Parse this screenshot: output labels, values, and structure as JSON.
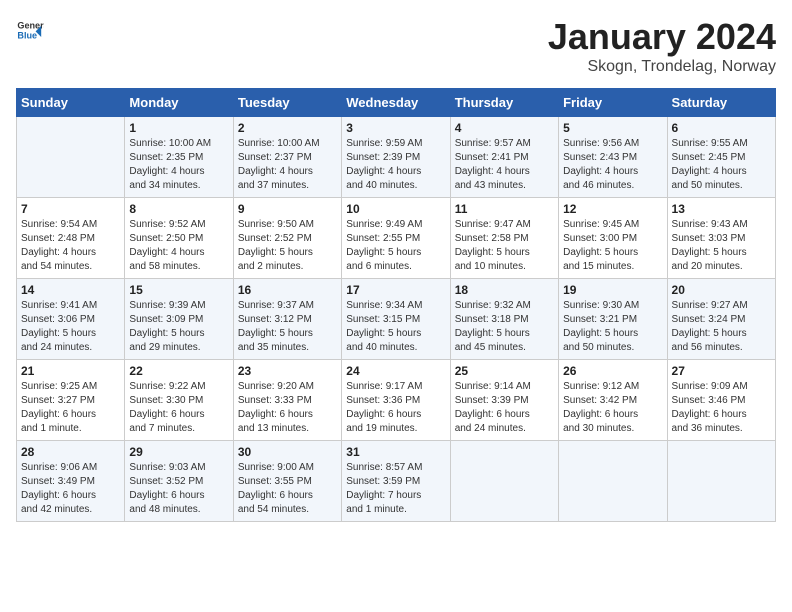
{
  "logo": {
    "general": "General",
    "blue": "Blue"
  },
  "title": "January 2024",
  "subtitle": "Skogn, Trondelag, Norway",
  "headers": [
    "Sunday",
    "Monday",
    "Tuesday",
    "Wednesday",
    "Thursday",
    "Friday",
    "Saturday"
  ],
  "weeks": [
    [
      {
        "day": "",
        "content": ""
      },
      {
        "day": "1",
        "content": "Sunrise: 10:00 AM\nSunset: 2:35 PM\nDaylight: 4 hours\nand 34 minutes."
      },
      {
        "day": "2",
        "content": "Sunrise: 10:00 AM\nSunset: 2:37 PM\nDaylight: 4 hours\nand 37 minutes."
      },
      {
        "day": "3",
        "content": "Sunrise: 9:59 AM\nSunset: 2:39 PM\nDaylight: 4 hours\nand 40 minutes."
      },
      {
        "day": "4",
        "content": "Sunrise: 9:57 AM\nSunset: 2:41 PM\nDaylight: 4 hours\nand 43 minutes."
      },
      {
        "day": "5",
        "content": "Sunrise: 9:56 AM\nSunset: 2:43 PM\nDaylight: 4 hours\nand 46 minutes."
      },
      {
        "day": "6",
        "content": "Sunrise: 9:55 AM\nSunset: 2:45 PM\nDaylight: 4 hours\nand 50 minutes."
      }
    ],
    [
      {
        "day": "7",
        "content": "Sunrise: 9:54 AM\nSunset: 2:48 PM\nDaylight: 4 hours\nand 54 minutes."
      },
      {
        "day": "8",
        "content": "Sunrise: 9:52 AM\nSunset: 2:50 PM\nDaylight: 4 hours\nand 58 minutes."
      },
      {
        "day": "9",
        "content": "Sunrise: 9:50 AM\nSunset: 2:52 PM\nDaylight: 5 hours\nand 2 minutes."
      },
      {
        "day": "10",
        "content": "Sunrise: 9:49 AM\nSunset: 2:55 PM\nDaylight: 5 hours\nand 6 minutes."
      },
      {
        "day": "11",
        "content": "Sunrise: 9:47 AM\nSunset: 2:58 PM\nDaylight: 5 hours\nand 10 minutes."
      },
      {
        "day": "12",
        "content": "Sunrise: 9:45 AM\nSunset: 3:00 PM\nDaylight: 5 hours\nand 15 minutes."
      },
      {
        "day": "13",
        "content": "Sunrise: 9:43 AM\nSunset: 3:03 PM\nDaylight: 5 hours\nand 20 minutes."
      }
    ],
    [
      {
        "day": "14",
        "content": "Sunrise: 9:41 AM\nSunset: 3:06 PM\nDaylight: 5 hours\nand 24 minutes."
      },
      {
        "day": "15",
        "content": "Sunrise: 9:39 AM\nSunset: 3:09 PM\nDaylight: 5 hours\nand 29 minutes."
      },
      {
        "day": "16",
        "content": "Sunrise: 9:37 AM\nSunset: 3:12 PM\nDaylight: 5 hours\nand 35 minutes."
      },
      {
        "day": "17",
        "content": "Sunrise: 9:34 AM\nSunset: 3:15 PM\nDaylight: 5 hours\nand 40 minutes."
      },
      {
        "day": "18",
        "content": "Sunrise: 9:32 AM\nSunset: 3:18 PM\nDaylight: 5 hours\nand 45 minutes."
      },
      {
        "day": "19",
        "content": "Sunrise: 9:30 AM\nSunset: 3:21 PM\nDaylight: 5 hours\nand 50 minutes."
      },
      {
        "day": "20",
        "content": "Sunrise: 9:27 AM\nSunset: 3:24 PM\nDaylight: 5 hours\nand 56 minutes."
      }
    ],
    [
      {
        "day": "21",
        "content": "Sunrise: 9:25 AM\nSunset: 3:27 PM\nDaylight: 6 hours\nand 1 minute."
      },
      {
        "day": "22",
        "content": "Sunrise: 9:22 AM\nSunset: 3:30 PM\nDaylight: 6 hours\nand 7 minutes."
      },
      {
        "day": "23",
        "content": "Sunrise: 9:20 AM\nSunset: 3:33 PM\nDaylight: 6 hours\nand 13 minutes."
      },
      {
        "day": "24",
        "content": "Sunrise: 9:17 AM\nSunset: 3:36 PM\nDaylight: 6 hours\nand 19 minutes."
      },
      {
        "day": "25",
        "content": "Sunrise: 9:14 AM\nSunset: 3:39 PM\nDaylight: 6 hours\nand 24 minutes."
      },
      {
        "day": "26",
        "content": "Sunrise: 9:12 AM\nSunset: 3:42 PM\nDaylight: 6 hours\nand 30 minutes."
      },
      {
        "day": "27",
        "content": "Sunrise: 9:09 AM\nSunset: 3:46 PM\nDaylight: 6 hours\nand 36 minutes."
      }
    ],
    [
      {
        "day": "28",
        "content": "Sunrise: 9:06 AM\nSunset: 3:49 PM\nDaylight: 6 hours\nand 42 minutes."
      },
      {
        "day": "29",
        "content": "Sunrise: 9:03 AM\nSunset: 3:52 PM\nDaylight: 6 hours\nand 48 minutes."
      },
      {
        "day": "30",
        "content": "Sunrise: 9:00 AM\nSunset: 3:55 PM\nDaylight: 6 hours\nand 54 minutes."
      },
      {
        "day": "31",
        "content": "Sunrise: 8:57 AM\nSunset: 3:59 PM\nDaylight: 7 hours\nand 1 minute."
      },
      {
        "day": "",
        "content": ""
      },
      {
        "day": "",
        "content": ""
      },
      {
        "day": "",
        "content": ""
      }
    ]
  ]
}
